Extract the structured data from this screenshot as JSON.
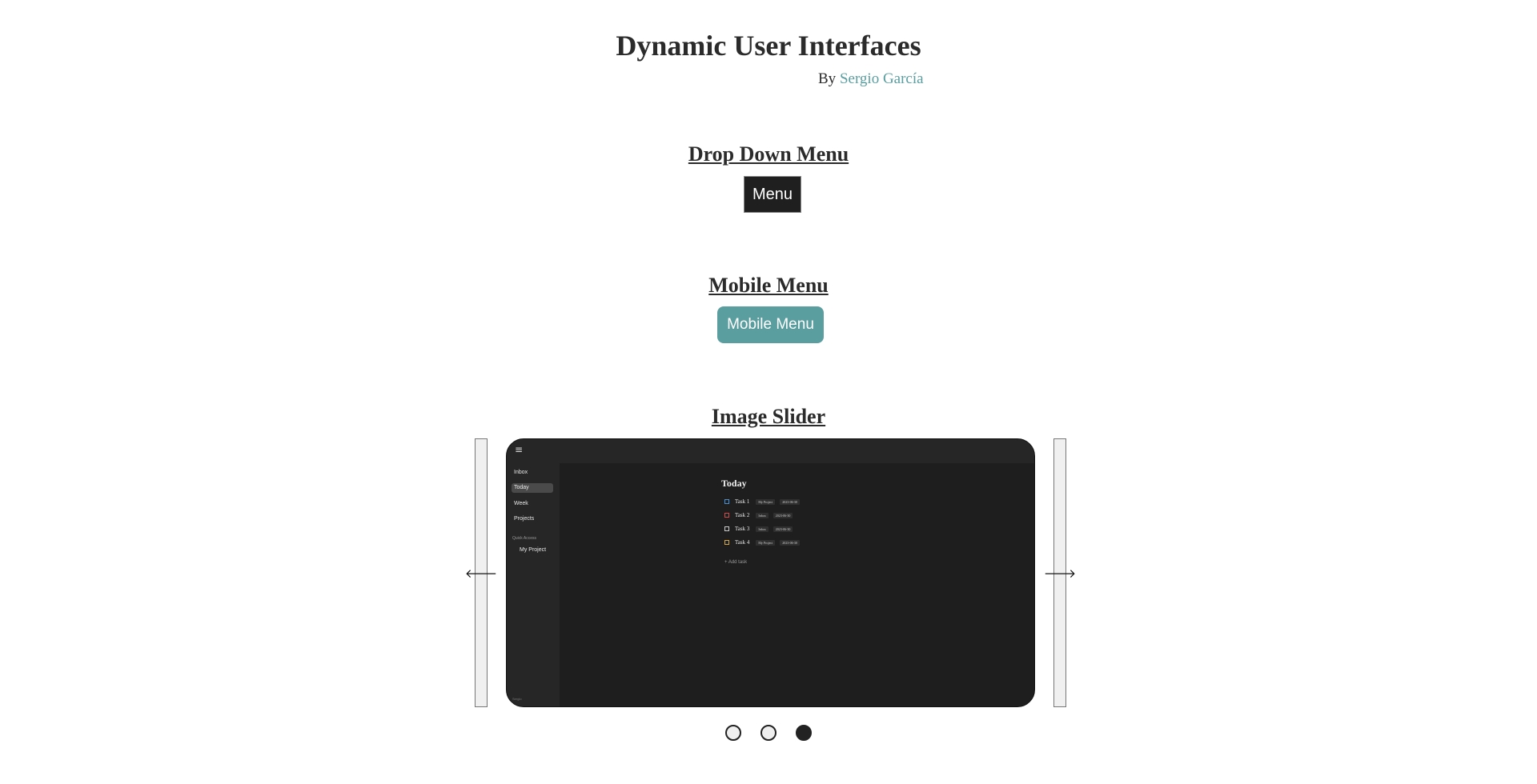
{
  "header": {
    "title": "Dynamic User Interfaces",
    "by_prefix": "By ",
    "author": "Sergio García"
  },
  "sections": {
    "dropdown": {
      "title": "Drop Down Menu",
      "button_label": "Menu"
    },
    "mobile": {
      "title": "Mobile Menu",
      "button_label": "Mobile Menu"
    },
    "slider": {
      "title": "Image Slider",
      "prev_icon": "arrow-left-icon",
      "next_icon": "arrow-right-icon",
      "prev_glyph": "🡐",
      "next_glyph": "🡒",
      "active_slide_index": 3,
      "slide_count": 3
    }
  },
  "slide": {
    "menu_glyph": "≡",
    "nav": [
      "Inbox",
      "Today",
      "Week",
      "Projects"
    ],
    "active_nav": "Today",
    "quick_access": "Quick Access",
    "project": "My Project",
    "footer": "Sergio",
    "heading": "Today",
    "tasks": [
      {
        "name": "Task 1",
        "project": "My Project",
        "date": "2023-06-30",
        "color": "#4a8fd6"
      },
      {
        "name": "Task 2",
        "project": "Inbox",
        "date": "2023-06-30",
        "color": "#d64a4a"
      },
      {
        "name": "Task 3",
        "project": "Inbox",
        "date": "2023-06-30",
        "color": "#cccccc"
      },
      {
        "name": "Task 4",
        "project": "My Project",
        "date": "2023-06-30",
        "color": "#d6a64a"
      }
    ],
    "add_task": "+ Add task"
  },
  "colors": {
    "accent": "#5a9ea0",
    "dark": "#1f1f1f"
  }
}
